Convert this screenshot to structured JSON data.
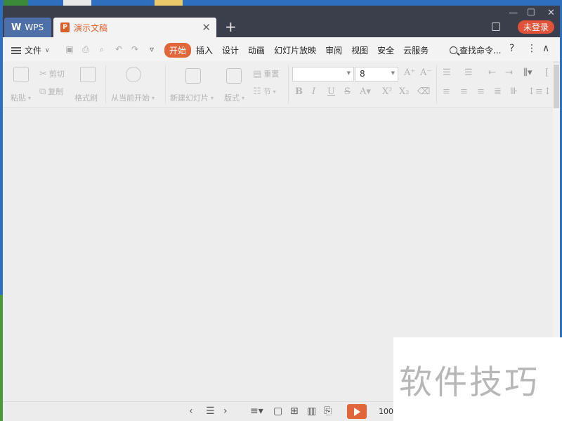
{
  "titlebar": {
    "wps_tab_label": "WPS",
    "doc_tab_label": "演示文稿",
    "close_symbol": "✕",
    "new_tab_symbol": "+",
    "minimize_symbol": "—",
    "maximize_symbol": "☐",
    "window_close_symbol": "✕",
    "login_label": "未登录"
  },
  "menubar": {
    "file_label": "文件",
    "tabs": [
      {
        "label": "开始",
        "active": true
      },
      {
        "label": "插入"
      },
      {
        "label": "设计"
      },
      {
        "label": "动画"
      },
      {
        "label": "幻灯片放映"
      },
      {
        "label": "审阅"
      },
      {
        "label": "视图"
      },
      {
        "label": "安全"
      },
      {
        "label": "云服务"
      }
    ],
    "search_label": "查找命令...",
    "help_symbol": "?",
    "more_symbol": "⋮",
    "collapse_symbol": "∧"
  },
  "ribbon": {
    "paste": "粘贴",
    "cut": "剪切",
    "copy": "复制",
    "format_painter": "格式刷",
    "play_from_current": "从当前开始",
    "new_slide": "新建幻灯片",
    "layout": "版式",
    "reset": "重置",
    "section": "节",
    "font_name": "",
    "font_size": "8"
  },
  "statusbar": {
    "zoom": "100"
  },
  "watermark": {
    "text": "软件技巧"
  },
  "colors": {
    "titlebar_bg": "#3b3f4c",
    "accent": "#e1673a",
    "wps_tab": "#4e6fa8",
    "login_bg": "#e0533a"
  }
}
